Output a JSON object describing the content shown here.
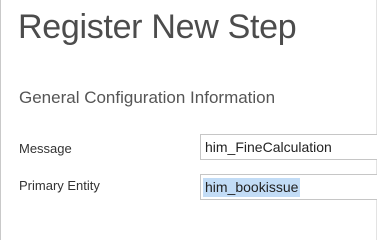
{
  "page": {
    "title": "Register New Step",
    "section_title": "General Configuration Information"
  },
  "fields": {
    "message": {
      "label": "Message",
      "value": "him_FineCalculation"
    },
    "primary_entity": {
      "label": "Primary Entity",
      "value": "him_bookissue",
      "value_selected": true
    }
  },
  "colors": {
    "title_text": "#4c4c4c",
    "selection_highlight": "#c2dcf6",
    "input_border": "#c6c6c6"
  }
}
